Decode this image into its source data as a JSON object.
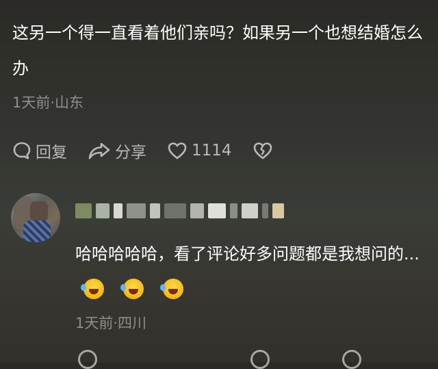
{
  "top_comment": {
    "text": "这另一个得一直看着他们亲吗？如果另一个也想结婚怎么办",
    "meta": "1天前·山东",
    "actions": {
      "reply_label": "回复",
      "share_label": "分享",
      "like_count": "1114"
    },
    "icons": [
      "reply-icon",
      "share-icon",
      "heart-icon",
      "dislike-icon"
    ]
  },
  "reply_comment": {
    "text": "哈哈哈哈哈，看了评论好多问题都是我想问的...",
    "emojis": [
      "laughing-tears-emoji",
      "laughing-tears-emoji",
      "laughing-tears-emoji"
    ],
    "meta": "1天前·四川"
  },
  "colors": {
    "text": "#ffffff",
    "meta": "#8e8e8a",
    "action": "#b9b9b5"
  }
}
